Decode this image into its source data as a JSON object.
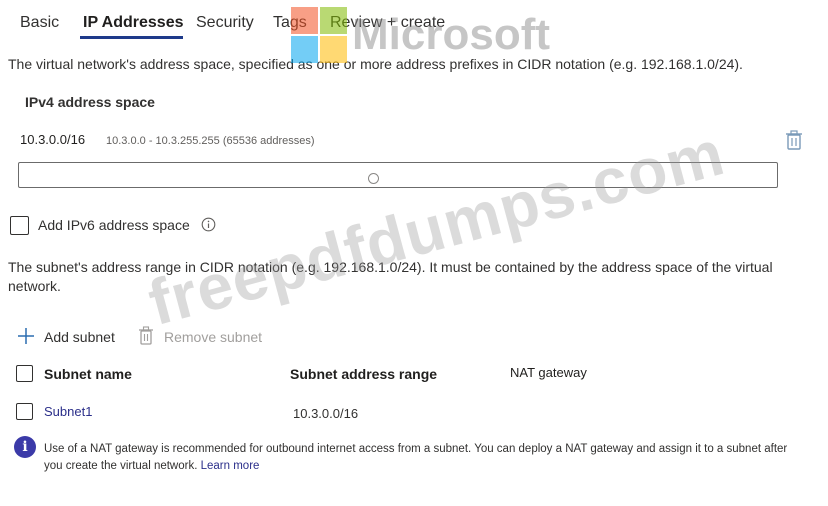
{
  "tabs": [
    {
      "label": "Basic",
      "active": false
    },
    {
      "label": "IP Addresses",
      "active": true
    },
    {
      "label": "Security",
      "active": false
    },
    {
      "label": "Tags",
      "active": false
    },
    {
      "label": "Review + create",
      "active": false
    }
  ],
  "address_space": {
    "description": "The virtual network's address space, specified as one or more address prefixes in CIDR notation (e.g. 192.168.1.0/24).",
    "ipv4_heading": "IPv4 address space",
    "prefix": "10.3.0.0/16",
    "range": "10.3.0.0 - 10.3.255.255 (65536 addresses)",
    "new_prefix_value": "",
    "delete_icon": "trash-icon"
  },
  "ipv6": {
    "label": "Add IPv6 address space",
    "checked": false,
    "info_icon": "info-circle-icon"
  },
  "subnets": {
    "description": "The subnet's address range in CIDR notation (e.g. 192.168.1.0/24). It must be contained by the address space of the virtual network.",
    "add_label": "Add subnet",
    "remove_label": "Remove subnet",
    "columns": [
      "Subnet name",
      "Subnet address range",
      "NAT gateway"
    ],
    "rows": [
      {
        "name": "Subnet1",
        "range": "10.3.0.0/16",
        "nat": ""
      }
    ]
  },
  "nat_info": {
    "text": "Use of a NAT gateway is recommended for outbound internet access from a subnet. You can deploy a NAT gateway and assign it to a subnet after you create the virtual network.",
    "link": "Learn more"
  },
  "watermarks": {
    "brand": "Microsoft",
    "site": "freepdfdumps.com"
  },
  "colors": {
    "accent": "#1e3a8a",
    "link": "#2b2f8a",
    "info": "#3b3aa8"
  }
}
